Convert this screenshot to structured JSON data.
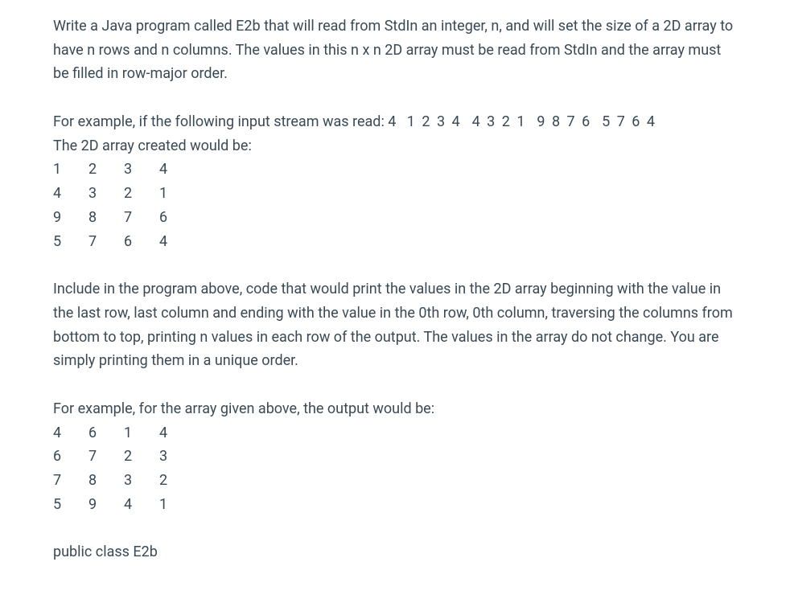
{
  "p1": "Write a Java program called E2b that will read from StdIn an integer, n, and will set the size of a 2D array to have n rows and n columns. The values in this n x n 2D array must be read from StdIn and the array must be filled in row-major order.",
  "p2_prefix": "For example, if the following input stream was read: 4   ",
  "p2_numbers": "1 2 3 4  4 3 2 1  9 8 7 6  5 7 6 4",
  "p2_line2": "The 2D array created would be:",
  "table1": [
    [
      "1",
      "2",
      "3",
      "4"
    ],
    [
      "4",
      "3",
      "2",
      "1"
    ],
    [
      "9",
      "8",
      "7",
      "6"
    ],
    [
      "5",
      "7",
      "6",
      "4"
    ]
  ],
  "p3": "Include in the program above, code that would print the values in the 2D array beginning with the value in the last row, last column and ending with the value in the 0th row, 0th column, traversing the columns from bottom to top, printing n values in each row of the output. The values in the array do not change. You are simply printing them in a unique order.",
  "p4": "For example, for the array given above, the output would be:",
  "table2": [
    [
      "4",
      "6",
      "1",
      "4"
    ],
    [
      "6",
      "7",
      "2",
      "3"
    ],
    [
      "7",
      "8",
      "3",
      "2"
    ],
    [
      "5",
      "9",
      "4",
      "1"
    ]
  ],
  "p5": "public class E2b"
}
